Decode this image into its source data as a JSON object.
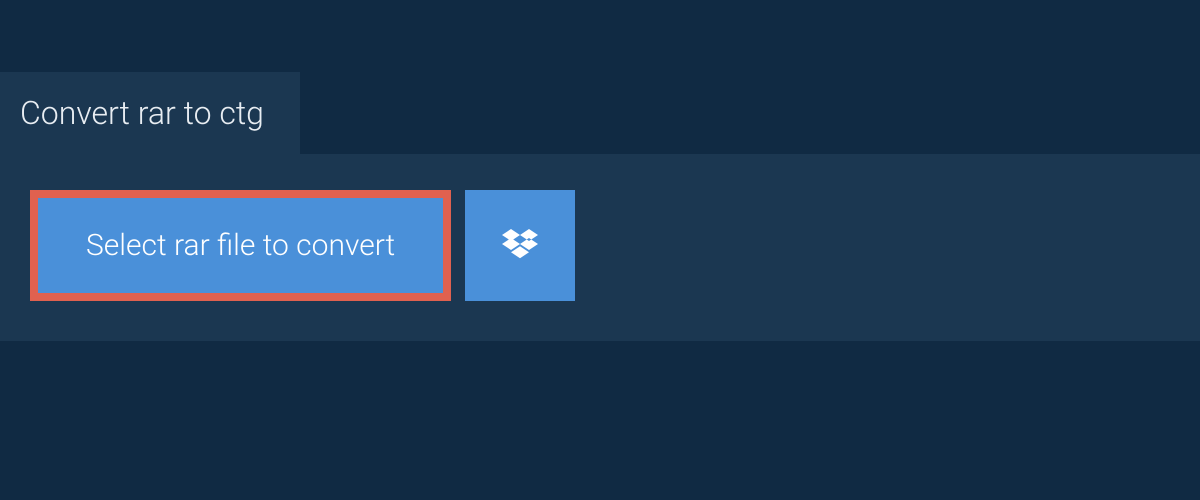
{
  "header": {
    "tab_label": "Convert rar to ctg"
  },
  "actions": {
    "select_file_label": "Select rar file to convert",
    "dropbox_icon": "dropbox-icon"
  },
  "colors": {
    "background": "#102a43",
    "panel": "#1b3751",
    "button_bg": "#4a90d9",
    "button_border_highlight": "#e0614f",
    "text_light": "#e8edf2"
  }
}
